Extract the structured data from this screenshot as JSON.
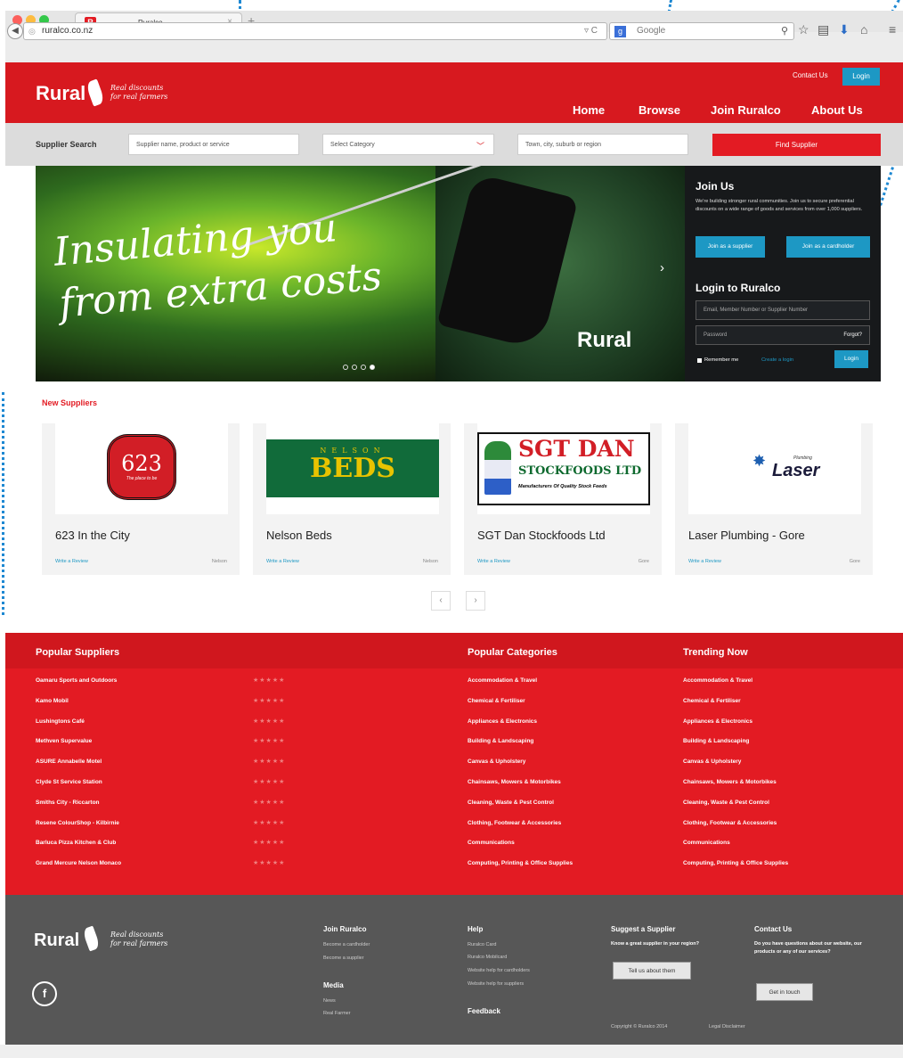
{
  "browser": {
    "tab_title": "Ruralco",
    "tab_favicon": "R",
    "url": "ruralco.co.nz",
    "search_placeholder": "Google"
  },
  "header": {
    "logo": "Rural",
    "tagline_line1": "Real discounts",
    "tagline_line2": "for real farmers",
    "contact_us": "Contact Us",
    "login": "Login",
    "nav": [
      "Home",
      "Browse",
      "Join Ruralco",
      "About Us"
    ]
  },
  "search": {
    "label": "Supplier Search",
    "keyword_placeholder": "Supplier name, product or service",
    "category_placeholder": "Select Category",
    "location_placeholder": "Town, city, suburb or region",
    "find_button": "Find Supplier"
  },
  "hero": {
    "line1": "Insulating you",
    "line2": "from extra costs",
    "logo": "Rural",
    "slide_count": 4,
    "active_slide": 4
  },
  "join": {
    "title": "Join Us",
    "text": "We're building stronger rural communities. Join us to secure preferential discounts on a wide range of goods and services from over 1,000 suppliers.",
    "supplier_button": "Join as a supplier",
    "cardholder_button": "Join as a cardholder"
  },
  "login": {
    "title": "Login to Ruralco",
    "user_placeholder": "Email, Member Number or Supplier Number",
    "password_placeholder": "Password",
    "forgot": "Forgot?",
    "remember": "Remember me",
    "create": "Create a login",
    "button": "Login"
  },
  "new_suppliers": {
    "title": "New Suppliers",
    "cards": [
      {
        "name": "623 In the City",
        "review": "Write a Review",
        "location": "Nelson",
        "logo_text": "623",
        "logo_sub": "The place to be"
      },
      {
        "name": "Nelson Beds",
        "review": "Write a Review",
        "location": "Nelson",
        "logo_text": "BEDS",
        "logo_sub": "NELSON"
      },
      {
        "name": "SGT Dan Stockfoods Ltd",
        "review": "Write a Review",
        "location": "Gore",
        "logo_text": "SGT DAN",
        "logo_sub": "STOCKFOODS LTD",
        "logo_sub2": "Manufacturers Of Quality Stock Feeds"
      },
      {
        "name": "Laser Plumbing - Gore",
        "review": "Write a Review",
        "location": "Gore",
        "logo_text": "Laser",
        "logo_sub": "Plumbing"
      }
    ],
    "prev": "‹",
    "next": "›"
  },
  "popular": {
    "suppliers_title": "Popular Suppliers",
    "categories_title": "Popular Categories",
    "trending_title": "Trending Now",
    "stars": "★★★★★",
    "suppliers": [
      "Oamaru Sports and Outdoors",
      "Kamo Mobil",
      "Lushingtons Café",
      "Methven Supervalue",
      "ASURE Annabelle Motel",
      "Clyde St Service Station",
      "Smiths City - Riccarton",
      "Resene ColourShop - Kilbirnie",
      "Barluca Pizza Kitchen & Club",
      "Grand Mercure Nelson Monaco"
    ],
    "categories": [
      "Accommodation & Travel",
      "Chemical & Fertiliser",
      "Appliances & Electronics",
      "Building & Landscaping",
      "Canvas & Upholstery",
      "Chainsaws, Mowers & Motorbikes",
      "Cleaning, Waste & Pest Control",
      "Clothing, Footwear & Accessories",
      "Communications",
      "Computing, Printing & Office Supplies"
    ],
    "trending": [
      "Accommodation & Travel",
      "Chemical & Fertiliser",
      "Appliances & Electronics",
      "Building & Landscaping",
      "Canvas & Upholstery",
      "Chainsaws, Mowers & Motorbikes",
      "Cleaning, Waste & Pest Control",
      "Clothing, Footwear & Accessories",
      "Communications",
      "Computing, Printing & Office Supplies"
    ]
  },
  "footer": {
    "logo": "Rural",
    "tagline_line1": "Real discounts",
    "tagline_line2": "for real farmers",
    "facebook": "f",
    "join_title": "Join Ruralco",
    "join_links": [
      "Become a cardholder",
      "Become a supplier"
    ],
    "media_title": "Media",
    "media_links": [
      "News",
      "Real Farmer"
    ],
    "help_title": "Help",
    "help_links": [
      "Ruralco Card",
      "Ruralco Mobilcard",
      "Website help for cardholders",
      "Website help for suppliers"
    ],
    "feedback": "Feedback",
    "suggest_title": "Suggest a Supplier",
    "suggest_text": "Know a great supplier in your region?",
    "suggest_button": "Tell us about them",
    "contact_title": "Contact Us",
    "contact_text": "Do you have questions about our website, our products or any of our services?",
    "contact_button": "Get in touch",
    "copyright": "Copyright © Ruralco 2014",
    "legal": "Legal Disclaimer"
  },
  "colors": {
    "brand_red": "#d7191f",
    "accent_blue": "#1d98c4",
    "footer_grey": "#575757"
  }
}
